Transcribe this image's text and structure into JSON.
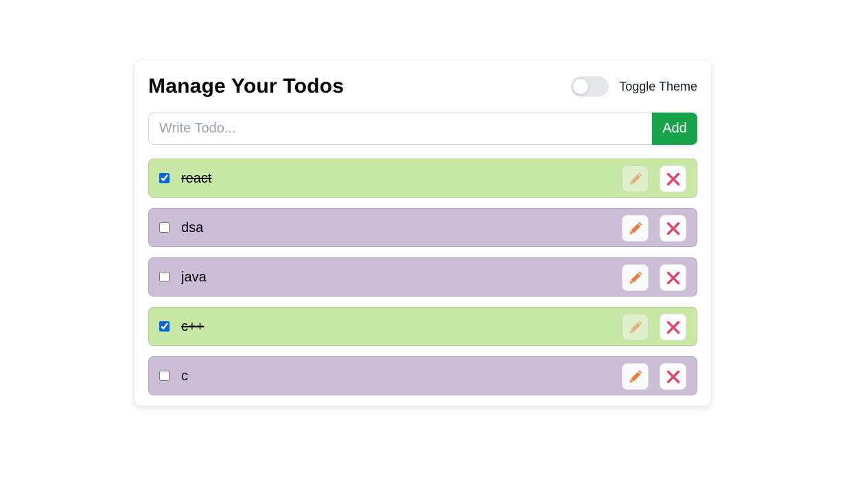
{
  "header": {
    "title": "Manage Your Todos",
    "theme_toggle_label": "Toggle Theme",
    "theme_dark": false
  },
  "form": {
    "placeholder": "Write Todo...",
    "value": "",
    "add_label": "Add"
  },
  "todos": [
    {
      "text": "react",
      "completed": true
    },
    {
      "text": "dsa",
      "completed": false
    },
    {
      "text": "java",
      "completed": false
    },
    {
      "text": "c++",
      "completed": true
    },
    {
      "text": "c",
      "completed": false
    }
  ],
  "icons": {
    "edit": "pencil-icon",
    "delete": "close-icon"
  },
  "colors": {
    "completed_bg": "#c8e9a6",
    "open_bg": "#cdbed8",
    "add_button": "#16a34a",
    "pencil": "#e97d3f",
    "close": "#e0436b",
    "checkbox": "#0a66d8"
  }
}
